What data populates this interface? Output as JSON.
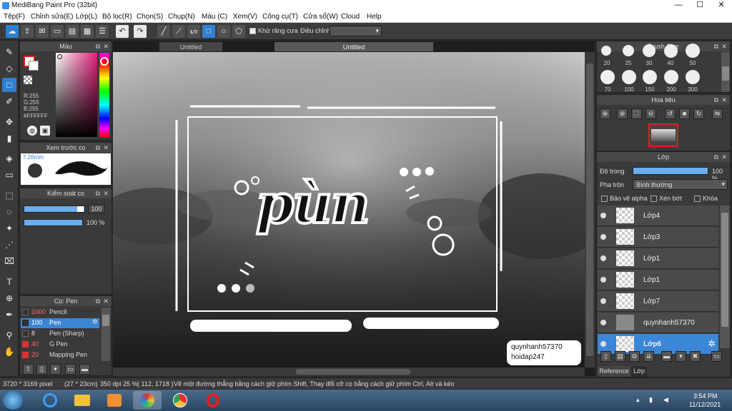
{
  "window": {
    "title": "MediBang Paint Pro (32bit)",
    "minimize": "—",
    "maximize": "☐",
    "close": "✕"
  },
  "menu": [
    "Tệp(F)",
    "Chỉnh sửa(E)",
    "Lớp(L)",
    "Bộ lọc(R)",
    "Chọn(S)",
    "Chụp(N)",
    "Màu (C)",
    "Xem(V)",
    "Công cụ(T)",
    "Cửa sổ(W)",
    "Cloud",
    "Help"
  ],
  "toolbar": {
    "antialias_label": "Khử răng cưa",
    "adjust_label": "Điều chỉnh"
  },
  "color_panel": {
    "title": "Màu",
    "r": "R:255",
    "g": "G:255",
    "b": "B:255",
    "hex": "#FFFFFF"
  },
  "brush_preview": {
    "title": "Xem trước cọ",
    "size": "7.26mm"
  },
  "brush_control": {
    "title": "Kiểm soát cọ",
    "size_value": "100",
    "opacity_value": "100 %"
  },
  "brush_list": {
    "title": "Cọ: Pen",
    "items": [
      {
        "num": "1000",
        "name": "Pencil",
        "color": "#333333"
      },
      {
        "num": "100",
        "name": "Pen",
        "color": "#3b86d6"
      },
      {
        "num": "8",
        "name": "Pen (Sharp)",
        "color": "#333333"
      },
      {
        "num": "40",
        "name": "G Pen",
        "color": "#e03030"
      },
      {
        "num": "20",
        "name": "Mapping Pen",
        "color": "#e03030"
      }
    ]
  },
  "tabs": {
    "tab1": "Untitled",
    "tab2": "Untitled"
  },
  "artwork": {
    "main_text": "pùn",
    "sig1": "quynhanh57370",
    "sig2": "hoidap247"
  },
  "brush_size": {
    "title": "Brush Size",
    "row1": [
      "20",
      "25",
      "30",
      "40",
      "50"
    ],
    "row2": [
      "70",
      "100",
      "150",
      "200",
      "300"
    ]
  },
  "navigator": {
    "title": "Hoa tiêu"
  },
  "layers": {
    "title": "Lớp",
    "opacity_label": "Độ trong",
    "opacity_value": "100 %",
    "blend_label": "Pha trộn",
    "blend_value": "Bình thường",
    "protect_alpha": "Bảo vệ alpha",
    "clipping": "Xén bớt",
    "lock": "Khóa",
    "items": [
      {
        "name": "Lớp4"
      },
      {
        "name": "Lớp3"
      },
      {
        "name": "Lớp1"
      },
      {
        "name": "Lớp1"
      },
      {
        "name": "Lớp7"
      },
      {
        "name": "quynhanh57370"
      },
      {
        "name": "Lớp6"
      }
    ]
  },
  "bottom_tabs": {
    "reference": "Reference",
    "layer": "Lớp"
  },
  "status": {
    "size": "3720 * 3169 pixel",
    "cm": "(27 * 23cm)",
    "dpi": "350 dpi",
    "zoom": "25 %",
    "coords": "( 112, 1718 )",
    "hint": "Vẽ một đường thẳng bằng cách giữ phím Shift, Thay đổi cỡ cọ bằng cách giữ phím Ctrl, Alt và kéo"
  },
  "taskbar": {
    "time": "3:54 PM",
    "date": "11/12/2021"
  }
}
